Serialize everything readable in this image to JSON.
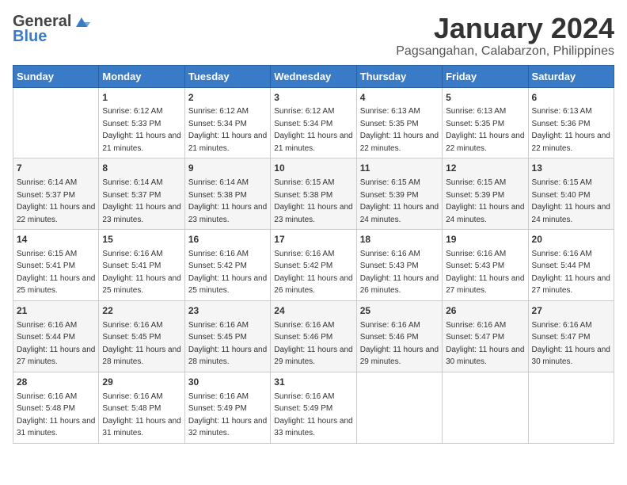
{
  "logo": {
    "general": "General",
    "blue": "Blue"
  },
  "title": "January 2024",
  "subtitle": "Pagsangahan, Calabarzon, Philippines",
  "days_of_week": [
    "Sunday",
    "Monday",
    "Tuesday",
    "Wednesday",
    "Thursday",
    "Friday",
    "Saturday"
  ],
  "weeks": [
    [
      {
        "day": "",
        "sunrise": "",
        "sunset": "",
        "daylight": ""
      },
      {
        "day": "1",
        "sunrise": "Sunrise: 6:12 AM",
        "sunset": "Sunset: 5:33 PM",
        "daylight": "Daylight: 11 hours and 21 minutes."
      },
      {
        "day": "2",
        "sunrise": "Sunrise: 6:12 AM",
        "sunset": "Sunset: 5:34 PM",
        "daylight": "Daylight: 11 hours and 21 minutes."
      },
      {
        "day": "3",
        "sunrise": "Sunrise: 6:12 AM",
        "sunset": "Sunset: 5:34 PM",
        "daylight": "Daylight: 11 hours and 21 minutes."
      },
      {
        "day": "4",
        "sunrise": "Sunrise: 6:13 AM",
        "sunset": "Sunset: 5:35 PM",
        "daylight": "Daylight: 11 hours and 22 minutes."
      },
      {
        "day": "5",
        "sunrise": "Sunrise: 6:13 AM",
        "sunset": "Sunset: 5:35 PM",
        "daylight": "Daylight: 11 hours and 22 minutes."
      },
      {
        "day": "6",
        "sunrise": "Sunrise: 6:13 AM",
        "sunset": "Sunset: 5:36 PM",
        "daylight": "Daylight: 11 hours and 22 minutes."
      }
    ],
    [
      {
        "day": "7",
        "sunrise": "Sunrise: 6:14 AM",
        "sunset": "Sunset: 5:37 PM",
        "daylight": "Daylight: 11 hours and 22 minutes."
      },
      {
        "day": "8",
        "sunrise": "Sunrise: 6:14 AM",
        "sunset": "Sunset: 5:37 PM",
        "daylight": "Daylight: 11 hours and 23 minutes."
      },
      {
        "day": "9",
        "sunrise": "Sunrise: 6:14 AM",
        "sunset": "Sunset: 5:38 PM",
        "daylight": "Daylight: 11 hours and 23 minutes."
      },
      {
        "day": "10",
        "sunrise": "Sunrise: 6:15 AM",
        "sunset": "Sunset: 5:38 PM",
        "daylight": "Daylight: 11 hours and 23 minutes."
      },
      {
        "day": "11",
        "sunrise": "Sunrise: 6:15 AM",
        "sunset": "Sunset: 5:39 PM",
        "daylight": "Daylight: 11 hours and 24 minutes."
      },
      {
        "day": "12",
        "sunrise": "Sunrise: 6:15 AM",
        "sunset": "Sunset: 5:39 PM",
        "daylight": "Daylight: 11 hours and 24 minutes."
      },
      {
        "day": "13",
        "sunrise": "Sunrise: 6:15 AM",
        "sunset": "Sunset: 5:40 PM",
        "daylight": "Daylight: 11 hours and 24 minutes."
      }
    ],
    [
      {
        "day": "14",
        "sunrise": "Sunrise: 6:15 AM",
        "sunset": "Sunset: 5:41 PM",
        "daylight": "Daylight: 11 hours and 25 minutes."
      },
      {
        "day": "15",
        "sunrise": "Sunrise: 6:16 AM",
        "sunset": "Sunset: 5:41 PM",
        "daylight": "Daylight: 11 hours and 25 minutes."
      },
      {
        "day": "16",
        "sunrise": "Sunrise: 6:16 AM",
        "sunset": "Sunset: 5:42 PM",
        "daylight": "Daylight: 11 hours and 25 minutes."
      },
      {
        "day": "17",
        "sunrise": "Sunrise: 6:16 AM",
        "sunset": "Sunset: 5:42 PM",
        "daylight": "Daylight: 11 hours and 26 minutes."
      },
      {
        "day": "18",
        "sunrise": "Sunrise: 6:16 AM",
        "sunset": "Sunset: 5:43 PM",
        "daylight": "Daylight: 11 hours and 26 minutes."
      },
      {
        "day": "19",
        "sunrise": "Sunrise: 6:16 AM",
        "sunset": "Sunset: 5:43 PM",
        "daylight": "Daylight: 11 hours and 27 minutes."
      },
      {
        "day": "20",
        "sunrise": "Sunrise: 6:16 AM",
        "sunset": "Sunset: 5:44 PM",
        "daylight": "Daylight: 11 hours and 27 minutes."
      }
    ],
    [
      {
        "day": "21",
        "sunrise": "Sunrise: 6:16 AM",
        "sunset": "Sunset: 5:44 PM",
        "daylight": "Daylight: 11 hours and 27 minutes."
      },
      {
        "day": "22",
        "sunrise": "Sunrise: 6:16 AM",
        "sunset": "Sunset: 5:45 PM",
        "daylight": "Daylight: 11 hours and 28 minutes."
      },
      {
        "day": "23",
        "sunrise": "Sunrise: 6:16 AM",
        "sunset": "Sunset: 5:45 PM",
        "daylight": "Daylight: 11 hours and 28 minutes."
      },
      {
        "day": "24",
        "sunrise": "Sunrise: 6:16 AM",
        "sunset": "Sunset: 5:46 PM",
        "daylight": "Daylight: 11 hours and 29 minutes."
      },
      {
        "day": "25",
        "sunrise": "Sunrise: 6:16 AM",
        "sunset": "Sunset: 5:46 PM",
        "daylight": "Daylight: 11 hours and 29 minutes."
      },
      {
        "day": "26",
        "sunrise": "Sunrise: 6:16 AM",
        "sunset": "Sunset: 5:47 PM",
        "daylight": "Daylight: 11 hours and 30 minutes."
      },
      {
        "day": "27",
        "sunrise": "Sunrise: 6:16 AM",
        "sunset": "Sunset: 5:47 PM",
        "daylight": "Daylight: 11 hours and 30 minutes."
      }
    ],
    [
      {
        "day": "28",
        "sunrise": "Sunrise: 6:16 AM",
        "sunset": "Sunset: 5:48 PM",
        "daylight": "Daylight: 11 hours and 31 minutes."
      },
      {
        "day": "29",
        "sunrise": "Sunrise: 6:16 AM",
        "sunset": "Sunset: 5:48 PM",
        "daylight": "Daylight: 11 hours and 31 minutes."
      },
      {
        "day": "30",
        "sunrise": "Sunrise: 6:16 AM",
        "sunset": "Sunset: 5:49 PM",
        "daylight": "Daylight: 11 hours and 32 minutes."
      },
      {
        "day": "31",
        "sunrise": "Sunrise: 6:16 AM",
        "sunset": "Sunset: 5:49 PM",
        "daylight": "Daylight: 11 hours and 33 minutes."
      },
      {
        "day": "",
        "sunrise": "",
        "sunset": "",
        "daylight": ""
      },
      {
        "day": "",
        "sunrise": "",
        "sunset": "",
        "daylight": ""
      },
      {
        "day": "",
        "sunrise": "",
        "sunset": "",
        "daylight": ""
      }
    ]
  ]
}
